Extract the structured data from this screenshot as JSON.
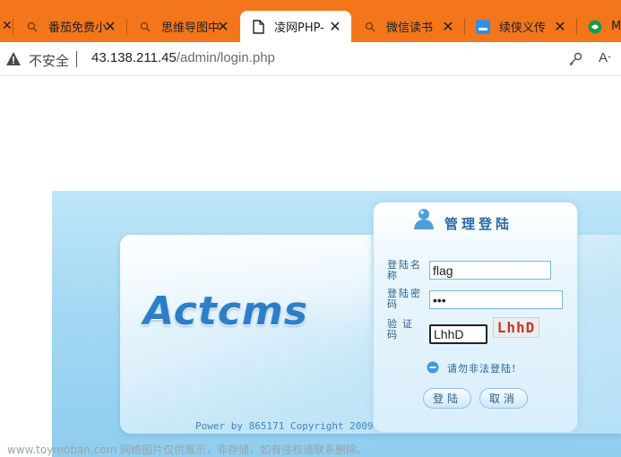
{
  "browser": {
    "tabs": [
      {
        "label": "番茄免费小",
        "icon": "search-icon",
        "active": false
      },
      {
        "label": "思维导图中",
        "icon": "search-icon",
        "active": false
      },
      {
        "label": "凌网PHP-",
        "icon": "page-icon",
        "active": true
      },
      {
        "label": "微信读书",
        "icon": "search-icon",
        "active": false
      },
      {
        "label": "续侠义传",
        "icon": "blue-app-icon",
        "active": false
      },
      {
        "label": "M",
        "icon": "green-logo-icon",
        "active": false
      }
    ],
    "close_glyph": "✕",
    "address": {
      "security_label": "不安全",
      "host": "43.138.211.45",
      "path": "/admin/login.php",
      "read_aloud_label": "A"
    }
  },
  "login": {
    "logo_text": "Actcms",
    "title": "管理登陆",
    "username_label": "登陆名称",
    "password_label": "登陆密码",
    "captcha_label": "验证码",
    "username_value": "flag",
    "password_value": "•••",
    "captcha_value": "LhhD",
    "captcha_image_text": "LhhD",
    "notice": "请勿非法登陆!",
    "login_button": "登陆",
    "cancel_button": "取消",
    "footer": "Power by 865171 Copyright 2009"
  },
  "watermark": "www.toymoban.com 网络图片仅供展示，非存储，如有侵权请联系删除。",
  "colors": {
    "tabbar": "#f3761b",
    "accent": "#2c7fc7",
    "panel": "#bfe6f8"
  }
}
